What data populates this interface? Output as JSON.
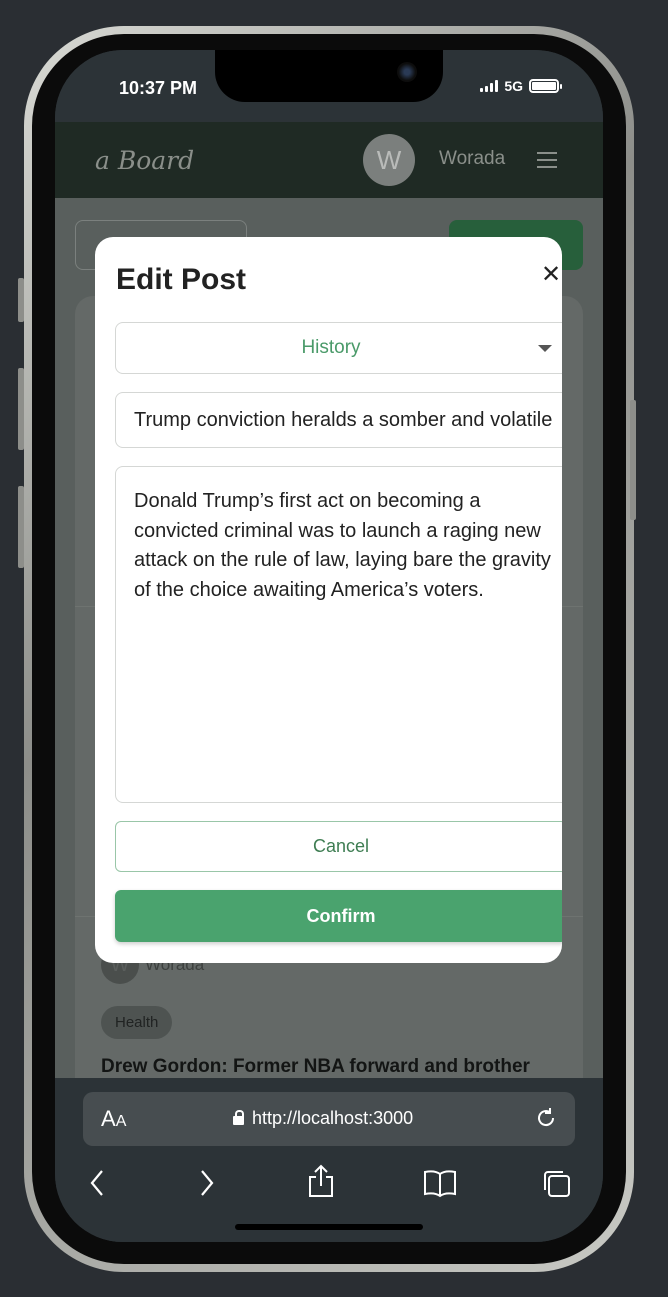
{
  "status_bar": {
    "time": "10:37 PM",
    "network": "5G"
  },
  "app": {
    "logo": "a Board",
    "avatar_initial": "W",
    "username": "Worada"
  },
  "modal": {
    "title": "Edit Post",
    "category": "History",
    "post_title": "Trump conviction heralds a somber and volatile",
    "post_body": "Donald Trump’s first act on becoming a convicted criminal was to launch a raging new attack on the rule of law, laying bare the gravity of the choice awaiting America’s voters.",
    "cancel_label": "Cancel",
    "confirm_label": "Confirm"
  },
  "background_post": {
    "author_initial": "W",
    "author": "Worada",
    "tag": "Health",
    "title": "Drew Gordon: Former NBA forward and brother"
  },
  "browser": {
    "text_size_label": "AA",
    "url": "http://localhost:3000"
  },
  "colors": {
    "accent_green": "#4aa36e",
    "header_bg": "#1f2a24"
  }
}
